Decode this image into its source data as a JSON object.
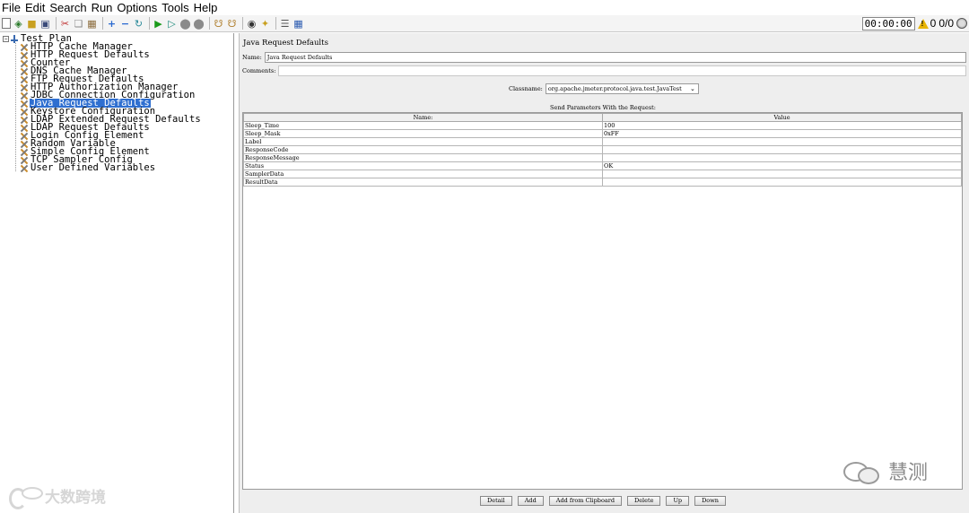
{
  "menu": {
    "items": [
      "File",
      "Edit",
      "Search",
      "Run",
      "Options",
      "Tools",
      "Help"
    ]
  },
  "toolbar": {
    "icons": [
      "new-icon",
      "templates-icon",
      "open-icon",
      "save-icon",
      "cut-icon",
      "copy-icon",
      "paste-icon",
      "expand-icon",
      "collapse-icon",
      "toggle-icon",
      "start-icon",
      "start-no-pause-icon",
      "stop-icon",
      "shutdown-icon",
      "clear-icon",
      "clear-all-icon",
      "search-icon",
      "reset-search-icon",
      "function-helper-icon",
      "help-icon"
    ],
    "timer": "00:00:00",
    "warning_count": "0",
    "threads": "0/0"
  },
  "tree": {
    "root": "Test Plan",
    "items": [
      "HTTP Cache Manager",
      "HTTP Request Defaults",
      "Counter",
      "DNS Cache Manager",
      "FTP Request Defaults",
      "HTTP Authorization Manager",
      "JDBC Connection Configuration",
      "Java Request Defaults",
      "Keystore Configuration",
      "LDAP Extended Request Defaults",
      "LDAP Request Defaults",
      "Login Config Element",
      "Random Variable",
      "Simple Config Element",
      "TCP Sampler Config",
      "User Defined Variables"
    ],
    "selected_index": 7
  },
  "panel": {
    "title": "Java Request Defaults",
    "name_label": "Name:",
    "name_value": "Java Request Defaults",
    "comments_label": "Comments:",
    "comments_value": "",
    "classname_label": "Classname:",
    "classname_value": "org.apache.jmeter.protocol.java.test.JavaTest",
    "section_title": "Send Parameters With the Request:",
    "table": {
      "headers": [
        "Name:",
        "Value"
      ],
      "rows": [
        [
          "Sleep_Time",
          "100"
        ],
        [
          "Sleep_Mask",
          "0xFF"
        ],
        [
          "Label",
          ""
        ],
        [
          "ResponseCode",
          ""
        ],
        [
          "ResponseMessage",
          ""
        ],
        [
          "Status",
          "OK"
        ],
        [
          "SamplerData",
          ""
        ],
        [
          "ResultData",
          ""
        ]
      ]
    },
    "buttons": [
      "Detail",
      "Add",
      "Add from Clipboard",
      "Delete",
      "Up",
      "Down"
    ]
  },
  "watermarks": {
    "left_text": "大数跨境",
    "right_text": "慧测"
  }
}
